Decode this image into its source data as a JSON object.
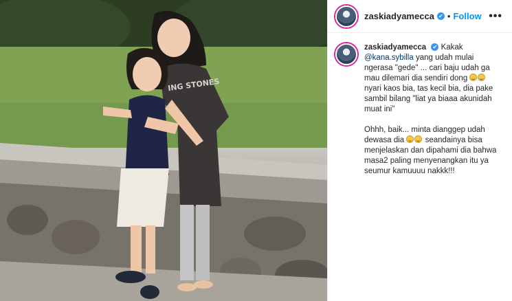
{
  "post": {
    "username": "zaskiadyamecca",
    "verified_mark": "✔",
    "separator": "•",
    "follow_label": "Follow",
    "more_label": "•••"
  },
  "caption": {
    "author": "zaskiadyamecca",
    "text_1a": "Kakak",
    "mention": "@kana.sybilla",
    "text_1b": "yang udah mulai ngerasa \"gede\" ... cari baju udah ga mau dilemari dia sendiri dong",
    "text_1c": "nyari kaos bia, tas kecil bia, dia pake sambil bilang \"liat ya biaaa akunidah muat ini\"",
    "text_2a": "Ohhh, baik... minta dianggep udah dewasa dia",
    "text_2b": "seandainya bisa menjelaskan dan dipahami dia bahwa masa2 paling menyenangkan itu ya seumur kamuuuu nakkk!!!",
    "emoji_name": "grinning-sweat-face"
  },
  "photo": {
    "shirt_text": "ING STONES"
  },
  "colors": {
    "follow": "#0095f6",
    "verified": "#3897f0",
    "mention": "#00376b"
  }
}
